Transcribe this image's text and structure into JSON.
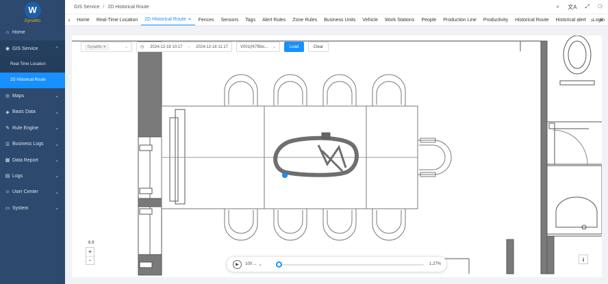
{
  "app": {
    "logo_letter": "W",
    "logo_text": "DynaWo"
  },
  "sidebar": {
    "items": [
      {
        "label": "Home",
        "icon": "home-icon",
        "glyph": "⌂"
      },
      {
        "label": "GIS Service",
        "icon": "globe-icon",
        "glyph": "◉",
        "open": true,
        "children": [
          {
            "label": "Real-Time Location"
          },
          {
            "label": "2D Historical Route",
            "active": true
          }
        ]
      },
      {
        "label": "Maps",
        "icon": "map-pin-icon",
        "glyph": "◎"
      },
      {
        "label": "Basic Data",
        "icon": "data-icon",
        "glyph": "◈"
      },
      {
        "label": "Rule Engine",
        "icon": "rule-icon",
        "glyph": "✎"
      },
      {
        "label": "Business Logs",
        "icon": "log-icon",
        "glyph": "☰"
      },
      {
        "label": "Data Report",
        "icon": "report-icon",
        "glyph": "▦"
      },
      {
        "label": "Logs",
        "icon": "logs-icon",
        "glyph": "▤"
      },
      {
        "label": "User Center",
        "icon": "user-icon",
        "glyph": "☺"
      },
      {
        "label": "System",
        "icon": "monitor-icon",
        "glyph": "▭"
      }
    ]
  },
  "breadcrumb": {
    "parent": "GIS Service",
    "separator": "/",
    "current": "2D Historical Route"
  },
  "header_icons": {
    "search": "⌕",
    "translate": "文A",
    "expand": "⤢",
    "user": "⚆"
  },
  "tabs": {
    "items": [
      {
        "label": "Home"
      },
      {
        "label": "Real-Time Location"
      },
      {
        "label": "2D Historical Route",
        "active": true
      },
      {
        "label": "Fences"
      },
      {
        "label": "Sensors"
      },
      {
        "label": "Tags"
      },
      {
        "label": "Alert Rules"
      },
      {
        "label": "Zone Rules"
      },
      {
        "label": "Business Units"
      },
      {
        "label": "Vehicle"
      },
      {
        "label": "Work Stations"
      },
      {
        "label": "People"
      },
      {
        "label": "Production Line"
      },
      {
        "label": "Productivity"
      },
      {
        "label": "Historical Route"
      },
      {
        "label": "Historical alert"
      },
      {
        "label": "Login"
      }
    ]
  },
  "filter": {
    "tag_value": "DynaWo",
    "start": "2024-12-18 10:17",
    "range_sep": "-",
    "end": "2024-12-18 11:17",
    "vehicle": "V001(f47f5bc...",
    "load_label": "Load",
    "clear_label": "Clear"
  },
  "zoom": {
    "level": "6.9",
    "in": "+",
    "out": "-"
  },
  "player": {
    "speed": "100 ...",
    "progress_pct": "1.27%",
    "progress": 0.0127
  },
  "colors": {
    "accent": "#1890ff",
    "sidebar": "#2d4a6e"
  }
}
